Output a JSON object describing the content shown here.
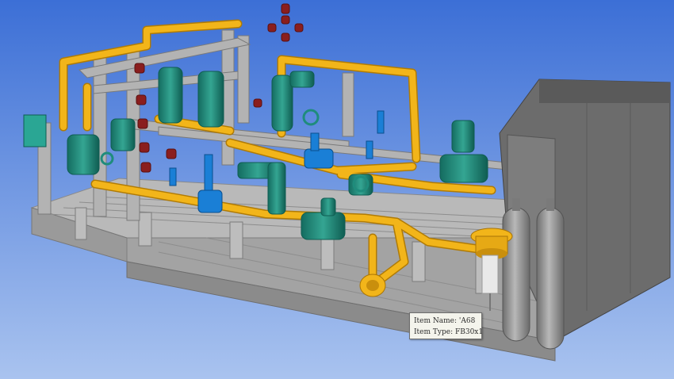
{
  "scene": {
    "background_top": "#3c6fd6",
    "background_bottom": "#a9c3ef",
    "pipe_color": "#f2b51a",
    "vessel_color": "#1f8c7c",
    "valve_blue": "#1a7fd6",
    "flange_red": "#8a1e1e",
    "frame_gray": "#a7a7a7",
    "skid_gray": "#c9c9c9",
    "tank_gray": "#8e8e8e"
  },
  "tooltip": {
    "name_label": "Item Name:",
    "name_value": "'A68",
    "type_label": "Item Type:",
    "type_value": "FB30x1"
  }
}
